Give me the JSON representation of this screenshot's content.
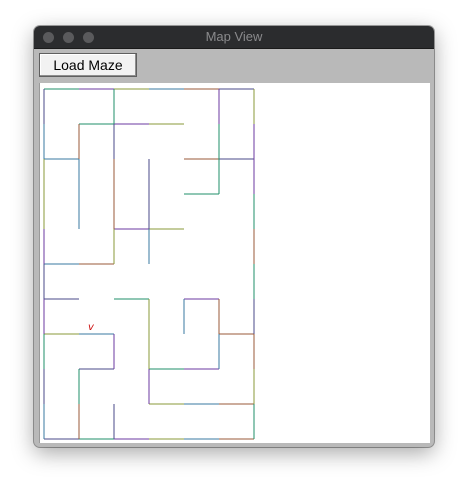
{
  "window": {
    "title": "Map View"
  },
  "toolbar": {
    "load_label": "Load Maze"
  },
  "maze": {
    "columns": 6,
    "rows": 10,
    "agent_glyph": "v",
    "agent_cell": {
      "col": 1,
      "row": 6
    },
    "wall_colors": [
      "#1f8f6a",
      "#6b3aa0",
      "#8a9a3a",
      "#3a7aa0",
      "#9a5a3a",
      "#4a4a8a"
    ],
    "h_walls": [
      [
        1,
        1,
        1,
        1,
        1,
        1
      ],
      [
        0,
        1,
        1,
        1,
        0,
        0
      ],
      [
        1,
        0,
        0,
        0,
        1,
        1
      ],
      [
        0,
        0,
        0,
        0,
        1,
        0
      ],
      [
        0,
        0,
        1,
        1,
        0,
        0
      ],
      [
        1,
        1,
        0,
        0,
        0,
        0
      ],
      [
        1,
        0,
        1,
        0,
        1,
        0
      ],
      [
        1,
        1,
        0,
        0,
        0,
        1
      ],
      [
        0,
        1,
        0,
        1,
        1,
        0
      ],
      [
        0,
        0,
        0,
        1,
        1,
        1
      ],
      [
        1,
        1,
        1,
        1,
        1,
        1
      ]
    ],
    "v_walls": [
      [
        1,
        0,
        1,
        0,
        0,
        1,
        1
      ],
      [
        1,
        1,
        1,
        0,
        0,
        1,
        1
      ],
      [
        1,
        1,
        1,
        1,
        0,
        1,
        1
      ],
      [
        1,
        1,
        1,
        1,
        0,
        0,
        1
      ],
      [
        1,
        0,
        1,
        1,
        0,
        0,
        1
      ],
      [
        1,
        0,
        0,
        0,
        0,
        0,
        1
      ],
      [
        1,
        0,
        0,
        1,
        1,
        1,
        1
      ],
      [
        1,
        0,
        1,
        1,
        0,
        1,
        1
      ],
      [
        1,
        1,
        0,
        1,
        0,
        0,
        1
      ],
      [
        1,
        1,
        1,
        0,
        0,
        0,
        1
      ]
    ]
  }
}
